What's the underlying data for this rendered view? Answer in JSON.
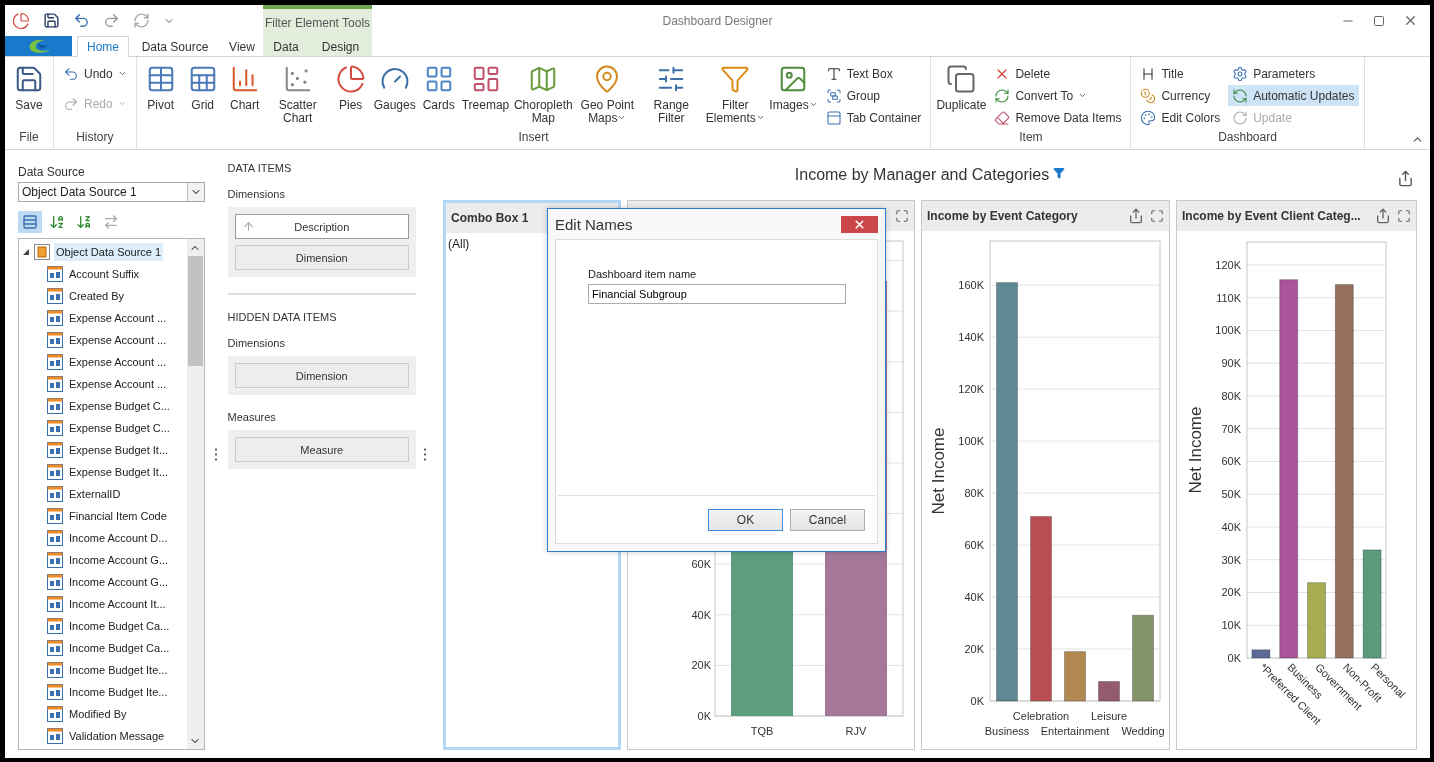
{
  "title_bar": {
    "title": "Dashboard Designer",
    "context_group": "Filter Element Tools"
  },
  "tabs": [
    {
      "label": "Home",
      "selected": true,
      "contextual": false
    },
    {
      "label": "Data Source",
      "selected": false,
      "contextual": false
    },
    {
      "label": "View",
      "selected": false,
      "contextual": false
    },
    {
      "label": "Data",
      "selected": false,
      "contextual": true
    },
    {
      "label": "Design",
      "selected": false,
      "contextual": true
    }
  ],
  "ribbon": {
    "groups": [
      {
        "label": "File",
        "large": [
          {
            "label": "Save",
            "dropdown": false
          }
        ]
      },
      {
        "label": "History",
        "small_columns": [
          [
            {
              "label": "Undo",
              "dropdown": true,
              "disabled": false,
              "on": false
            },
            {
              "label": "Redo",
              "dropdown": true,
              "disabled": true,
              "on": false
            }
          ]
        ]
      },
      {
        "label": "Insert",
        "large": [
          {
            "label": "Pivot",
            "dropdown": false
          },
          {
            "label": "Grid",
            "dropdown": false
          },
          {
            "label": "Chart",
            "dropdown": false
          },
          {
            "label": "Scatter Chart",
            "dropdown": false
          },
          {
            "label": "Pies",
            "dropdown": false
          },
          {
            "label": "Gauges",
            "dropdown": false
          },
          {
            "label": "Cards",
            "dropdown": false
          },
          {
            "label": "Treemap",
            "dropdown": false
          },
          {
            "label": "Choropleth Map",
            "dropdown": false
          },
          {
            "label": "Geo Point Maps",
            "dropdown": true
          },
          {
            "label": "Range Filter",
            "dropdown": false
          },
          {
            "label": "Filter Elements",
            "dropdown": true
          },
          {
            "label": "Images",
            "dropdown": true
          }
        ],
        "small_columns": [
          [
            {
              "label": "Text Box",
              "dropdown": false,
              "disabled": false,
              "on": false
            },
            {
              "label": "Group",
              "dropdown": false,
              "disabled": false,
              "on": false
            },
            {
              "label": "Tab Container",
              "dropdown": false,
              "disabled": false,
              "on": false
            }
          ]
        ]
      },
      {
        "label": "Item",
        "large": [
          {
            "label": "Duplicate",
            "dropdown": false
          }
        ],
        "small_columns": [
          [
            {
              "label": "Delete",
              "dropdown": false,
              "disabled": false,
              "on": false
            },
            {
              "label": "Convert To",
              "dropdown": true,
              "disabled": false,
              "on": false
            },
            {
              "label": "Remove Data Items",
              "dropdown": false,
              "disabled": false,
              "on": false
            }
          ]
        ]
      },
      {
        "label": "Dashboard",
        "small_columns": [
          [
            {
              "label": "Title",
              "dropdown": false,
              "disabled": false,
              "on": false
            },
            {
              "label": "Currency",
              "dropdown": false,
              "disabled": false,
              "on": false
            },
            {
              "label": "Edit Colors",
              "dropdown": false,
              "disabled": false,
              "on": false
            }
          ],
          [
            {
              "label": "Parameters",
              "dropdown": false,
              "disabled": false,
              "on": false
            },
            {
              "label": "Automatic Updates",
              "dropdown": false,
              "disabled": false,
              "on": true
            },
            {
              "label": "Update",
              "dropdown": false,
              "disabled": true,
              "on": false
            }
          ]
        ]
      }
    ]
  },
  "data_source_panel": {
    "label": "Data Source",
    "select_value": "Object Data Source 1",
    "toolbar": [
      {
        "selected": true,
        "disabled": false
      },
      {
        "selected": false,
        "disabled": false
      },
      {
        "selected": false,
        "disabled": false
      },
      {
        "selected": false,
        "disabled": true
      }
    ],
    "tree": {
      "label": "Object Data Source 1",
      "expanded": true,
      "selected": true,
      "children": [
        {
          "label": "Account Suffix",
          "selected": false
        },
        {
          "label": "Created By",
          "selected": false
        },
        {
          "label": "Expense Account ...",
          "selected": false
        },
        {
          "label": "Expense Account ...",
          "selected": false
        },
        {
          "label": "Expense Account ...",
          "selected": false
        },
        {
          "label": "Expense Account ...",
          "selected": false
        },
        {
          "label": "Expense Budget C...",
          "selected": false
        },
        {
          "label": "Expense Budget C...",
          "selected": false
        },
        {
          "label": "Expense Budget It...",
          "selected": false
        },
        {
          "label": "Expense Budget It...",
          "selected": false
        },
        {
          "label": "ExternalID",
          "selected": false
        },
        {
          "label": "Financial Item Code",
          "selected": false
        },
        {
          "label": "Income Account D...",
          "selected": false
        },
        {
          "label": "Income Account G...",
          "selected": false
        },
        {
          "label": "Income Account G...",
          "selected": false
        },
        {
          "label": "Income Account It...",
          "selected": false
        },
        {
          "label": "Income Budget Ca...",
          "selected": false
        },
        {
          "label": "Income Budget Ca...",
          "selected": false
        },
        {
          "label": "Income Budget Ite...",
          "selected": false
        },
        {
          "label": "Income Budget Ite...",
          "selected": false
        },
        {
          "label": "Modified By",
          "selected": false
        },
        {
          "label": "Validation Message",
          "selected": false
        }
      ]
    }
  },
  "data_items_panel": {
    "sections": [
      {
        "heading": "DATA ITEMS",
        "groups": [
          {
            "label": "Dimensions",
            "slots": [
              {
                "label": "Description",
                "kind": "bound"
              },
              {
                "label": "Dimension",
                "kind": "empty"
              }
            ]
          }
        ]
      },
      {
        "heading": "HIDDEN DATA ITEMS",
        "groups": [
          {
            "label": "Dimensions",
            "slots": [
              {
                "label": "Dimension",
                "kind": "empty"
              }
            ]
          },
          {
            "label": "Measures",
            "slots": [
              {
                "label": "Measure",
                "kind": "empty"
              }
            ]
          }
        ]
      }
    ]
  },
  "dashboard": {
    "title": "Income by Manager and Categories",
    "filtered": true,
    "items": [
      {
        "kind": "combo",
        "title": "Combo Box 1",
        "selected": true,
        "value": "(All)"
      },
      {
        "kind": "partial_chart",
        "selected": false,
        "yticks": [
          "60K",
          "40K",
          "20K",
          "0K"
        ],
        "categories": [
          "TQB",
          "RJV"
        ]
      },
      {
        "kind": "chart",
        "title": "Income by Event Category",
        "selected": false,
        "chart_data": {
          "type": "bar",
          "grid": true,
          "ylabel": "Net Income",
          "categories": [
            "Business",
            "Celebration",
            "Entertainment",
            "Leisure",
            "Wedding"
          ],
          "values": [
            161000,
            71000,
            19000,
            7500,
            33000
          ],
          "ylim": [
            0,
            177000
          ],
          "yticks": [
            {
              "value": 0,
              "label": "0K"
            },
            {
              "value": 20000,
              "label": "20K"
            },
            {
              "value": 40000,
              "label": "40K"
            },
            {
              "value": 60000,
              "label": "60K"
            },
            {
              "value": 80000,
              "label": "80K"
            },
            {
              "value": 100000,
              "label": "100K"
            },
            {
              "value": 120000,
              "label": "120K"
            },
            {
              "value": 140000,
              "label": "140K"
            },
            {
              "value": 160000,
              "label": "160K"
            }
          ]
        }
      },
      {
        "kind": "chart",
        "title": "Income by Event Client Categ...",
        "selected": false,
        "chart_data": {
          "type": "bar",
          "grid": true,
          "ylabel": "Net Income",
          "categories": [
            "*Preferred Client",
            "Business",
            "Government",
            "Non-Profit",
            "Personal"
          ],
          "values": [
            2500,
            115500,
            23000,
            114000,
            33000
          ],
          "ylim": [
            0,
            127000
          ],
          "yticks": [
            {
              "value": 0,
              "label": "0K"
            },
            {
              "value": 10000,
              "label": "10K"
            },
            {
              "value": 20000,
              "label": "20K"
            },
            {
              "value": 30000,
              "label": "30K"
            },
            {
              "value": 40000,
              "label": "40K"
            },
            {
              "value": 50000,
              "label": "50K"
            },
            {
              "value": 60000,
              "label": "60K"
            },
            {
              "value": 70000,
              "label": "70K"
            },
            {
              "value": 80000,
              "label": "80K"
            },
            {
              "value": 90000,
              "label": "90K"
            },
            {
              "value": 100000,
              "label": "100K"
            },
            {
              "value": 110000,
              "label": "110K"
            },
            {
              "value": 120000,
              "label": "120K"
            }
          ]
        }
      }
    ]
  },
  "dialog": {
    "title": "Edit Names",
    "field_label": "Dashboard item name",
    "field_value": "Financial Subgroup",
    "buttons": [
      {
        "label": "OK",
        "focused": true
      },
      {
        "label": "Cancel",
        "focused": false
      }
    ]
  }
}
